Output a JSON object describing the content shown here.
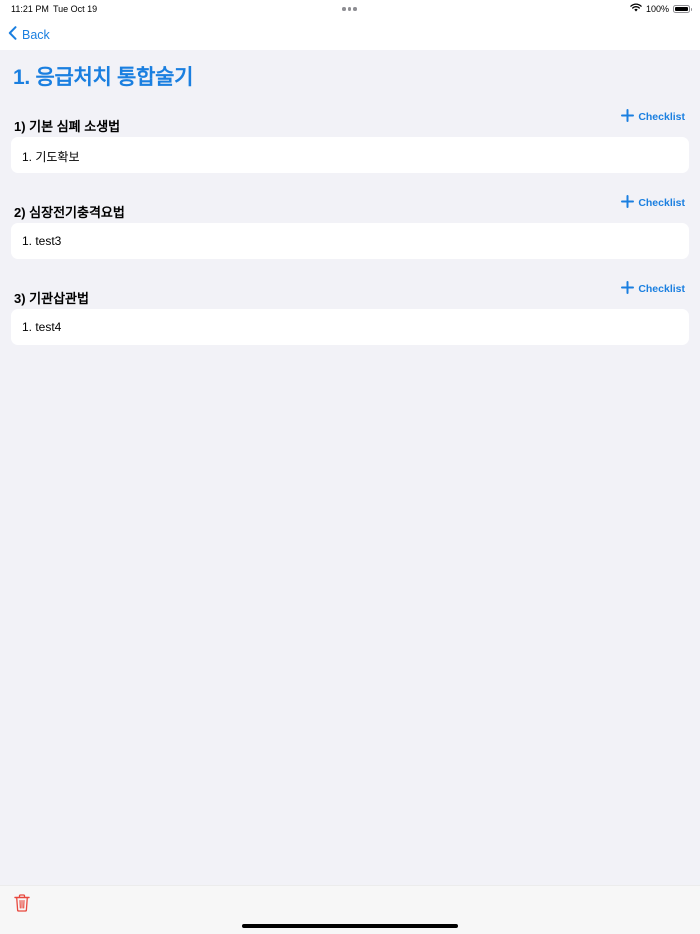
{
  "status_bar": {
    "time": "11:21 PM",
    "date": "Tue Oct 19",
    "battery_text": "100%",
    "battery_level": 1.0
  },
  "nav": {
    "back_label": "Back"
  },
  "page_title": "1. 응급처치 통합술기",
  "sections": [
    {
      "title": "1) 기본 심폐 소생법",
      "add_label": "Checklist",
      "items": [
        "1. 기도확보"
      ]
    },
    {
      "title": "2) 심장전기충격요법",
      "add_label": "Checklist",
      "items": [
        "1. test3"
      ]
    },
    {
      "title": "3) 기관삽관법",
      "add_label": "Checklist",
      "items": [
        "1. test4"
      ]
    }
  ],
  "toolbar": {
    "trash_icon": "trash-icon"
  },
  "colors": {
    "accent": "#1a7fe0",
    "background": "#f2f2f7",
    "card": "#ffffff",
    "destructive": "#e8473d"
  }
}
